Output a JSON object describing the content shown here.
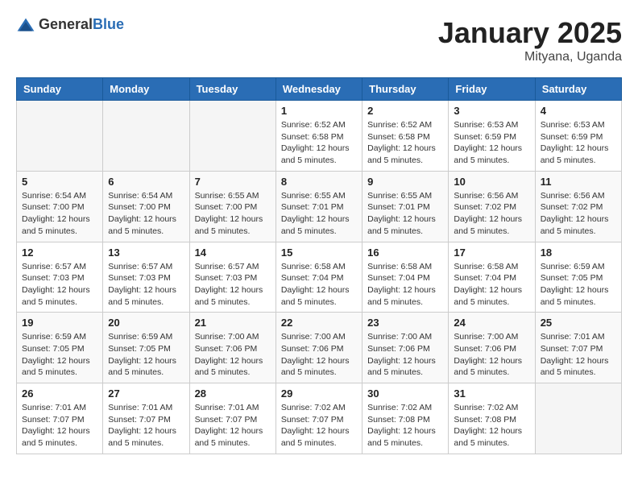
{
  "header": {
    "logo_general": "General",
    "logo_blue": "Blue",
    "month_year": "January 2025",
    "location": "Mityana, Uganda"
  },
  "days_of_week": [
    "Sunday",
    "Monday",
    "Tuesday",
    "Wednesday",
    "Thursday",
    "Friday",
    "Saturday"
  ],
  "weeks": [
    [
      {
        "day": "",
        "info": ""
      },
      {
        "day": "",
        "info": ""
      },
      {
        "day": "",
        "info": ""
      },
      {
        "day": "1",
        "info": "Sunrise: 6:52 AM\nSunset: 6:58 PM\nDaylight: 12 hours\nand 5 minutes."
      },
      {
        "day": "2",
        "info": "Sunrise: 6:52 AM\nSunset: 6:58 PM\nDaylight: 12 hours\nand 5 minutes."
      },
      {
        "day": "3",
        "info": "Sunrise: 6:53 AM\nSunset: 6:59 PM\nDaylight: 12 hours\nand 5 minutes."
      },
      {
        "day": "4",
        "info": "Sunrise: 6:53 AM\nSunset: 6:59 PM\nDaylight: 12 hours\nand 5 minutes."
      }
    ],
    [
      {
        "day": "5",
        "info": "Sunrise: 6:54 AM\nSunset: 7:00 PM\nDaylight: 12 hours\nand 5 minutes."
      },
      {
        "day": "6",
        "info": "Sunrise: 6:54 AM\nSunset: 7:00 PM\nDaylight: 12 hours\nand 5 minutes."
      },
      {
        "day": "7",
        "info": "Sunrise: 6:55 AM\nSunset: 7:00 PM\nDaylight: 12 hours\nand 5 minutes."
      },
      {
        "day": "8",
        "info": "Sunrise: 6:55 AM\nSunset: 7:01 PM\nDaylight: 12 hours\nand 5 minutes."
      },
      {
        "day": "9",
        "info": "Sunrise: 6:55 AM\nSunset: 7:01 PM\nDaylight: 12 hours\nand 5 minutes."
      },
      {
        "day": "10",
        "info": "Sunrise: 6:56 AM\nSunset: 7:02 PM\nDaylight: 12 hours\nand 5 minutes."
      },
      {
        "day": "11",
        "info": "Sunrise: 6:56 AM\nSunset: 7:02 PM\nDaylight: 12 hours\nand 5 minutes."
      }
    ],
    [
      {
        "day": "12",
        "info": "Sunrise: 6:57 AM\nSunset: 7:03 PM\nDaylight: 12 hours\nand 5 minutes."
      },
      {
        "day": "13",
        "info": "Sunrise: 6:57 AM\nSunset: 7:03 PM\nDaylight: 12 hours\nand 5 minutes."
      },
      {
        "day": "14",
        "info": "Sunrise: 6:57 AM\nSunset: 7:03 PM\nDaylight: 12 hours\nand 5 minutes."
      },
      {
        "day": "15",
        "info": "Sunrise: 6:58 AM\nSunset: 7:04 PM\nDaylight: 12 hours\nand 5 minutes."
      },
      {
        "day": "16",
        "info": "Sunrise: 6:58 AM\nSunset: 7:04 PM\nDaylight: 12 hours\nand 5 minutes."
      },
      {
        "day": "17",
        "info": "Sunrise: 6:58 AM\nSunset: 7:04 PM\nDaylight: 12 hours\nand 5 minutes."
      },
      {
        "day": "18",
        "info": "Sunrise: 6:59 AM\nSunset: 7:05 PM\nDaylight: 12 hours\nand 5 minutes."
      }
    ],
    [
      {
        "day": "19",
        "info": "Sunrise: 6:59 AM\nSunset: 7:05 PM\nDaylight: 12 hours\nand 5 minutes."
      },
      {
        "day": "20",
        "info": "Sunrise: 6:59 AM\nSunset: 7:05 PM\nDaylight: 12 hours\nand 5 minutes."
      },
      {
        "day": "21",
        "info": "Sunrise: 7:00 AM\nSunset: 7:06 PM\nDaylight: 12 hours\nand 5 minutes."
      },
      {
        "day": "22",
        "info": "Sunrise: 7:00 AM\nSunset: 7:06 PM\nDaylight: 12 hours\nand 5 minutes."
      },
      {
        "day": "23",
        "info": "Sunrise: 7:00 AM\nSunset: 7:06 PM\nDaylight: 12 hours\nand 5 minutes."
      },
      {
        "day": "24",
        "info": "Sunrise: 7:00 AM\nSunset: 7:06 PM\nDaylight: 12 hours\nand 5 minutes."
      },
      {
        "day": "25",
        "info": "Sunrise: 7:01 AM\nSunset: 7:07 PM\nDaylight: 12 hours\nand 5 minutes."
      }
    ],
    [
      {
        "day": "26",
        "info": "Sunrise: 7:01 AM\nSunset: 7:07 PM\nDaylight: 12 hours\nand 5 minutes."
      },
      {
        "day": "27",
        "info": "Sunrise: 7:01 AM\nSunset: 7:07 PM\nDaylight: 12 hours\nand 5 minutes."
      },
      {
        "day": "28",
        "info": "Sunrise: 7:01 AM\nSunset: 7:07 PM\nDaylight: 12 hours\nand 5 minutes."
      },
      {
        "day": "29",
        "info": "Sunrise: 7:02 AM\nSunset: 7:07 PM\nDaylight: 12 hours\nand 5 minutes."
      },
      {
        "day": "30",
        "info": "Sunrise: 7:02 AM\nSunset: 7:08 PM\nDaylight: 12 hours\nand 5 minutes."
      },
      {
        "day": "31",
        "info": "Sunrise: 7:02 AM\nSunset: 7:08 PM\nDaylight: 12 hours\nand 5 minutes."
      },
      {
        "day": "",
        "info": ""
      }
    ]
  ]
}
